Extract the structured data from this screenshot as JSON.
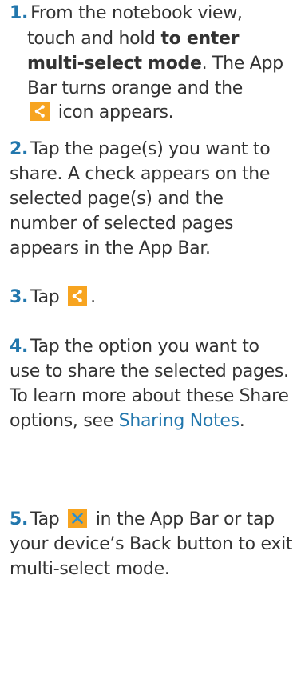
{
  "steps": [
    {
      "number": "1.",
      "line1": "From the notebook view,",
      "part_a": "touch and hold",
      "bold": "to enter multi-select mode",
      "part_b": ". The App Bar turns orange and the",
      "icon": "share-icon",
      "part_c": "icon appears."
    },
    {
      "number": "2.",
      "text": "Tap the page(s) you want to share. A check appears on the selected page(s) and the number of selected pages appears in the App Bar."
    },
    {
      "number": "3.",
      "before": "Tap",
      "icon": "share-icon",
      "after": "."
    },
    {
      "number": "4.",
      "text": "Tap the option you want to use to share the selected pages. To learn more about these Share options, see",
      "link": "Sharing Notes",
      "after": "."
    },
    {
      "number": "5.",
      "before": "Tap",
      "icon": "close-icon",
      "after": "in the App Bar or tap your device’s Back button to exit multi-select mode."
    }
  ],
  "colors": {
    "number": "#2277ad",
    "chip": "#f7a420",
    "link": "#2277ad",
    "text": "#333333"
  }
}
